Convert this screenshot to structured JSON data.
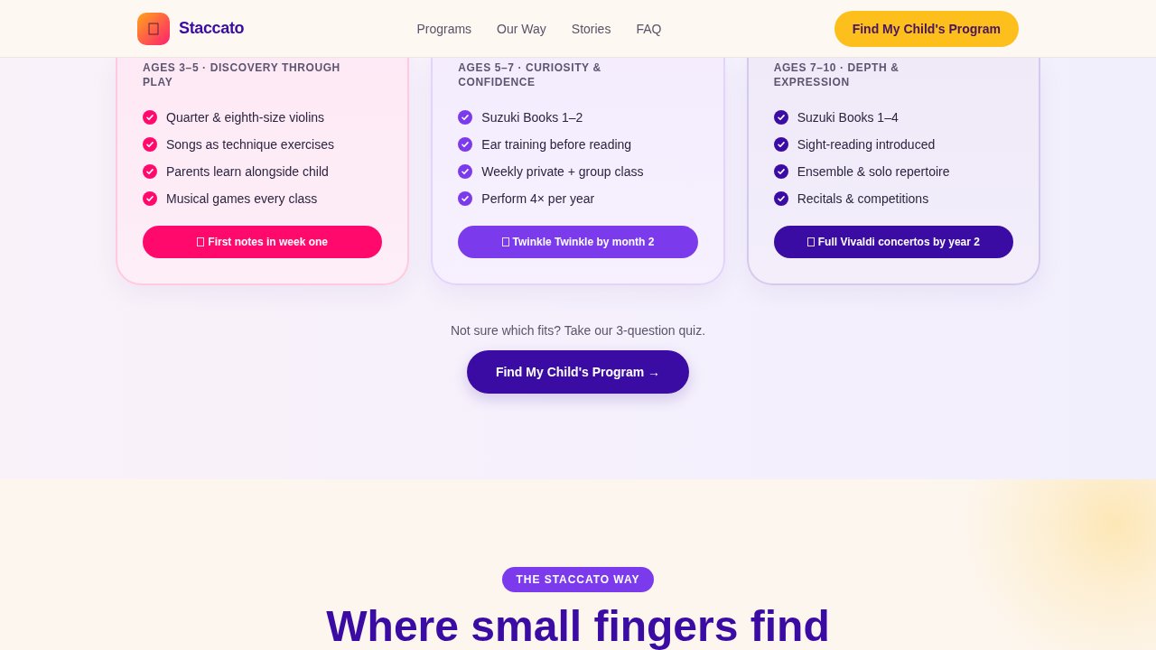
{
  "header": {
    "brand": "Staccato",
    "nav": [
      "Programs",
      "Our Way",
      "Stories",
      "FAQ"
    ],
    "cta": "Find My Child's Program"
  },
  "programs": {
    "cards": [
      {
        "eyebrow": "AGES 3–5 · DISCOVERY THROUGH PLAY",
        "color": "#ff0a6c",
        "features": [
          "Quarter & eighth-size violins",
          "Songs as technique exercises",
          "Parents learn alongside child",
          "Musical games every class"
        ],
        "milestone": "First notes in week one"
      },
      {
        "eyebrow": "AGES 5–7 · CURIOSITY & CONFIDENCE",
        "color": "#7c3aed",
        "features": [
          "Suzuki Books 1–2",
          "Ear training before reading",
          "Weekly private + group class",
          "Perform 4× per year"
        ],
        "milestone": "Twinkle Twinkle by month 2"
      },
      {
        "eyebrow": "AGES 7–10 · DEPTH & EXPRESSION",
        "color": "#3a0ca3",
        "features": [
          "Suzuki Books 1–4",
          "Sight-reading introduced",
          "Ensemble & solo repertoire",
          "Recitals & competitions"
        ],
        "milestone": "Full Vivaldi concertos by year 2"
      }
    ],
    "quiz_prompt": "Not sure which fits? Take our 3-question quiz.",
    "quiz_button": "Find My Child's Program →"
  },
  "way": {
    "tag": "THE STACCATO WAY",
    "heading": "Where small fingers find"
  }
}
